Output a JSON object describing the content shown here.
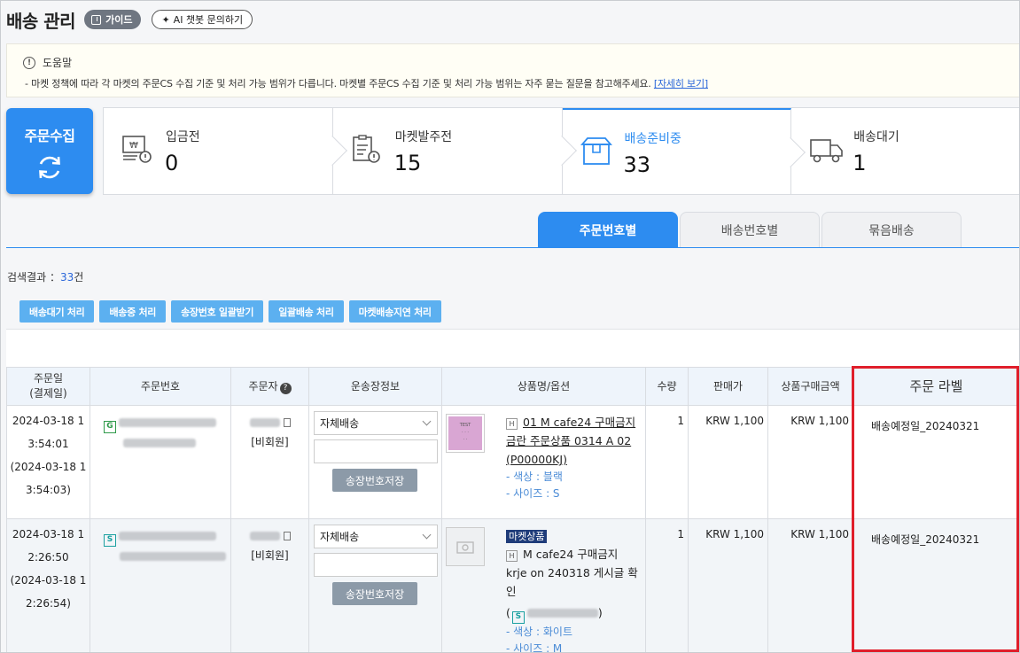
{
  "header": {
    "title": "배송 관리",
    "guide_label": "가이드",
    "ai_label": "AI 챗봇 문의하기"
  },
  "help": {
    "title": "도움말",
    "text": "- 마켓 정책에 따라 각 마켓의 주문CS 수집 기준 및 처리 가능 범위가 다릅니다. 마켓별 주문CS 수집 기준 및 처리 가능 범위는 자주 묻는 질문을 참고해주세요.",
    "link": "[자세히 보기]"
  },
  "collect": {
    "label": "주문수집"
  },
  "status_cards": [
    {
      "name": "입금전",
      "count": "0",
      "icon": "deposit-icon"
    },
    {
      "name": "마켓발주전",
      "count": "15",
      "icon": "clipboard-alert-icon"
    },
    {
      "name": "배송준비중",
      "count": "33",
      "icon": "box-icon"
    },
    {
      "name": "배송대기",
      "count": "1",
      "icon": "truck-icon"
    }
  ],
  "tabs": [
    "주문번호별",
    "배송번호별",
    "묶음배송"
  ],
  "result": {
    "label": "검색결과 ：",
    "count": "33",
    "unit": "건"
  },
  "actions": [
    "배송대기 처리",
    "배송중 처리",
    "송장번호 일괄받기",
    "일괄배송 처리",
    "마켓배송지연 처리"
  ],
  "table": {
    "headers": [
      "주문일\n(결제일)",
      "주문번호",
      "주문자",
      "운송장정보",
      "상품명/옵션",
      "수량",
      "판매가",
      "상품구매금액",
      "주문 라벨"
    ],
    "rows": [
      {
        "date1": "2024-03-18 1",
        "date2": "3:54:01",
        "date3": "(2024-03-18 1",
        "date4": "3:54:03)",
        "market_badge": "G",
        "member": "[비회원]",
        "carrier": "자체배송",
        "save": "송장번호저장",
        "h": "H",
        "product": "01 M cafe24 구매금지 금란 주문상품 0314 A 02 (P00000KJ)",
        "opt1": "- 색상 : 블랙",
        "opt2": "- 사이즈 : S",
        "qty": "1",
        "price": "KRW 1,100",
        "amount": "KRW 1,100",
        "label": "배송예정일_20240321"
      },
      {
        "date1": "2024-03-18 1",
        "date2": "2:26:50",
        "date3": "(2024-03-18 1",
        "date4": "2:26:54)",
        "market_badge": "S",
        "member": "[비회원]",
        "carrier": "자체배송",
        "save": "송장번호저장",
        "tag": "마켓상품",
        "h": "H",
        "product": "M cafe24 구매금지 krje on 240318 게시글 확인",
        "paren_open": "(",
        "paren_close": ")",
        "opt1": "- 색상 : 화이트",
        "opt2": "- 사이즈 : M",
        "qty": "1",
        "price": "KRW 1,100",
        "amount": "KRW 1,100",
        "label": "배송예정일_20240321"
      }
    ]
  },
  "colors": {
    "accent": "#2d8cf0",
    "highlight": "#e01f2b"
  }
}
